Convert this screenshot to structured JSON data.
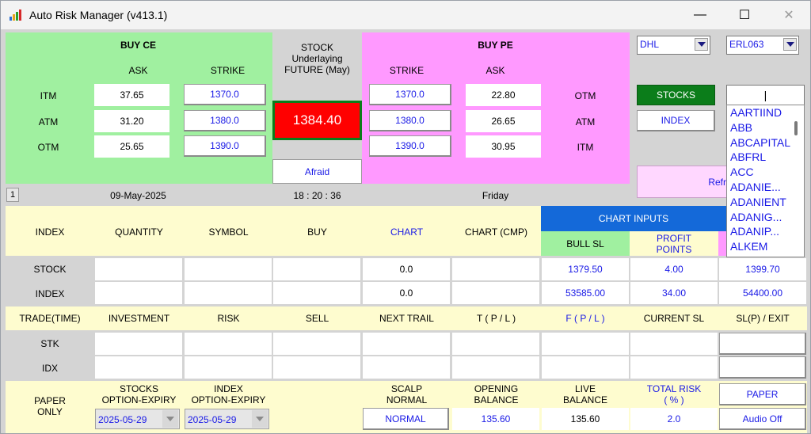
{
  "window": {
    "title": "Auto Risk Manager (v413.1)",
    "minimize": "—",
    "maximize": "☐",
    "close": "✕"
  },
  "colors": {
    "green": "#a0f0a0",
    "pink": "#ff99ff",
    "yellow": "#fefccf",
    "red": "#ff0000",
    "dark_green": "#0b7d1a",
    "blue": "#1a1ae6",
    "chart_blue": "#1469d9"
  },
  "buy_ce": {
    "title": "BUY CE",
    "ask_header": "ASK",
    "strike_header": "STRIKE",
    "rows": [
      {
        "label": "ITM",
        "ask": "37.65",
        "strike": "1370.0"
      },
      {
        "label": "ATM",
        "ask": "31.20",
        "strike": "1380.0"
      },
      {
        "label": "OTM",
        "ask": "25.65",
        "strike": "1390.0"
      }
    ]
  },
  "stock_panel": {
    "line1": "STOCK",
    "line2": "Underlaying",
    "line3": "FUTURE (May)",
    "price": "1384.40",
    "afraid": "Afraid"
  },
  "buy_pe": {
    "title": "BUY PE",
    "strike_header": "STRIKE",
    "ask_header": "ASK",
    "rows": [
      {
        "strike": "1370.0",
        "ask": "22.80",
        "label": "OTM"
      },
      {
        "strike": "1380.0",
        "ask": "26.65",
        "label": "ATM"
      },
      {
        "strike": "1390.0",
        "ask": "30.95",
        "label": "ITM"
      }
    ]
  },
  "right_panel": {
    "combo1": "DHL",
    "combo2": "ERL063",
    "stocks_btn": "STOCKS",
    "index_btn": "INDEX",
    "refresh_btn": "Refre",
    "search_value": "|",
    "list": [
      "AARTIIND",
      "ABB",
      "ABCAPITAL",
      "ABFRL",
      "ACC",
      "ADANIE...",
      "ADANIENT",
      "ADANIG...",
      "ADANIP...",
      "ALKEM"
    ]
  },
  "status": {
    "page": "1",
    "date": "09-May-2025",
    "time": "18 : 20 : 36",
    "day": "Friday"
  },
  "grid": {
    "headers": {
      "index": "INDEX",
      "quantity": "QUANTITY",
      "symbol": "SYMBOL",
      "buy": "BUY",
      "chart": "CHART",
      "chart_cmp": "CHART (CMP)",
      "chart_inputs": "CHART INPUTS",
      "bull_sl": "BULL SL",
      "profit": "PROFIT POINTS",
      "profit_line1": "PROFIT",
      "profit_line2": "POINTS"
    },
    "stock_row": {
      "label": "STOCK",
      "chart": "0.0",
      "bull_sl": "1379.50",
      "profit": "4.00",
      "extra": "1399.70"
    },
    "index_row": {
      "label": "INDEX",
      "chart": "0.0",
      "bull_sl": "53585.00",
      "profit": "34.00",
      "extra": "54400.00"
    },
    "headers2": {
      "trade_time": "TRADE(TIME)",
      "investment": "INVESTMENT",
      "risk": "RISK",
      "sell": "SELL",
      "next_trail": "NEXT TRAIL",
      "tpl": "T ( P / L )",
      "fpl": "F ( P / L )",
      "current_sl": "CURRENT SL",
      "slp_exit": "SL(P) / EXIT"
    },
    "stk_label": "STK",
    "idx_label": "IDX"
  },
  "bottom": {
    "paper_only_1": "PAPER",
    "paper_only_2": "ONLY",
    "stocks_expiry_1": "STOCKS",
    "stocks_expiry_2": "OPTION-EXPIRY",
    "index_expiry_1": "INDEX",
    "index_expiry_2": "OPTION-EXPIRY",
    "scalp_1": "SCALP",
    "scalp_2": "NORMAL",
    "opening_1": "OPENING",
    "opening_2": "BALANCE",
    "live_1": "LIVE",
    "live_2": "BALANCE",
    "total_risk_1": "TOTAL RISK",
    "total_risk_2": "( % )",
    "paper_btn": "PAPER",
    "stocks_expiry_value": "2025-05-29",
    "index_expiry_value": "2025-05-29",
    "normal_btn": "NORMAL",
    "opening_value": "135.60",
    "live_value": "135.60",
    "total_risk_value": "2.0",
    "audio_btn": "Audio Off"
  }
}
